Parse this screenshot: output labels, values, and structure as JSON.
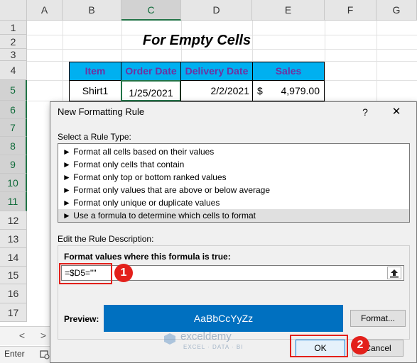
{
  "sheet": {
    "columns": [
      "A",
      "B",
      "C",
      "D",
      "E",
      "F",
      "G"
    ],
    "rows": [
      "1",
      "2",
      "3",
      "4",
      "5",
      "6",
      "7",
      "8",
      "9",
      "10",
      "11",
      "12",
      "13",
      "14",
      "15",
      "16",
      "17"
    ],
    "title": "For Empty Cells",
    "table_headers": [
      "Item",
      "Order Date",
      "Delivery Date",
      "Sales"
    ],
    "row5": {
      "item": "Shirt1",
      "order_date": "1/25/2021",
      "delivery_date": "2/2/2021",
      "currency": "$",
      "sales": "4,979.00"
    }
  },
  "dialog": {
    "title": "New Formatting Rule",
    "help_label": "?",
    "close_label": "✕",
    "select_rule_type_label": "Select a Rule Type:",
    "rule_types": [
      "► Format all cells based on their values",
      "► Format only cells that contain",
      "► Format only top or bottom ranked values",
      "► Format only values that are above or below average",
      "► Format only unique or duplicate values",
      "► Use a formula to determine which cells to format"
    ],
    "edit_description_label": "Edit the Rule Description:",
    "formula_label": "Format values where this formula is true:",
    "formula_value": "=$D5=\"\"",
    "preview_label": "Preview:",
    "preview_text": "AaBbCcYyZz",
    "format_button": "Format...",
    "ok_button": "OK",
    "cancel_button": "Cancel",
    "callouts": [
      "1",
      "2"
    ]
  },
  "statusbar": {
    "mode": "Enter",
    "nav_prev": "<",
    "nav_next": ">"
  },
  "watermark": {
    "brand": "exceldemy",
    "tagline": "EXCEL · DATA · BI"
  },
  "colors": {
    "header_fill": "#00b0f0",
    "header_text": "#7030a0",
    "preview_fill": "#0070c0",
    "callout_red": "#e3201b",
    "excel_green": "#217346"
  }
}
